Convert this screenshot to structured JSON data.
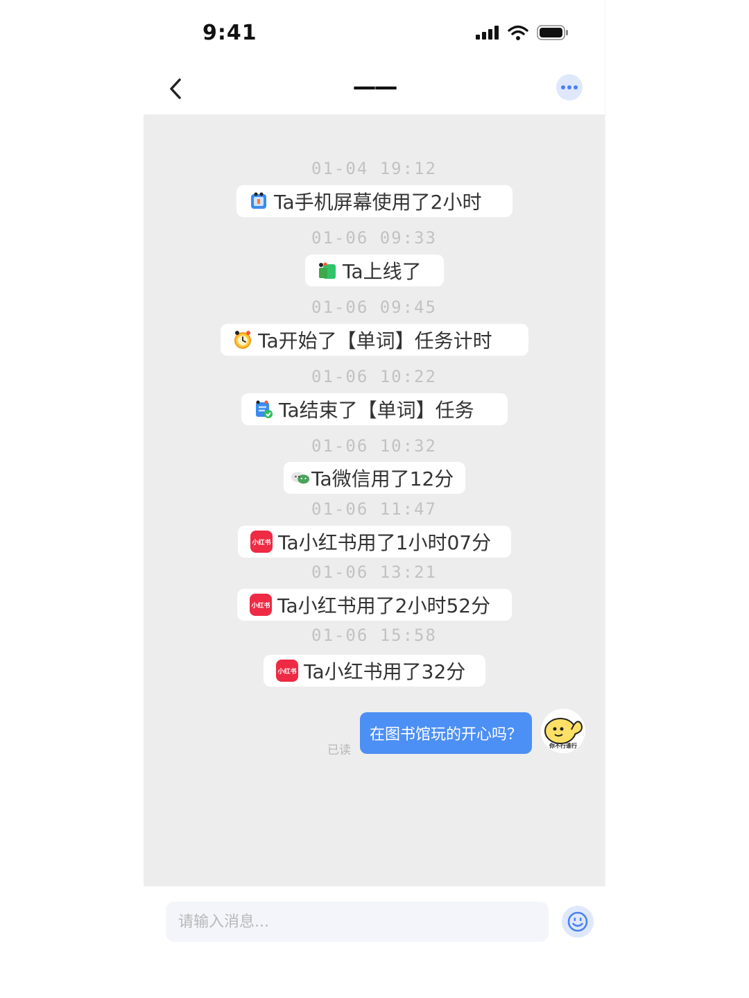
{
  "status_bar": {
    "time": "9:41"
  },
  "nav": {
    "title": "——"
  },
  "events": [
    {
      "timestamp": "01-04  19:12",
      "icon": "phone-screen-icon",
      "text": "Ta手机屏幕使用了2小时"
    },
    {
      "timestamp": "01-06  09:33",
      "icon": "online-app-icon",
      "text": "Ta上线了"
    },
    {
      "timestamp": "01-06  09:45",
      "icon": "alarm-clock-icon",
      "text": "Ta开始了【单词】任务计时"
    },
    {
      "timestamp": "01-06  10:22",
      "icon": "task-done-icon",
      "text": "Ta结束了【单词】任务"
    },
    {
      "timestamp": "01-06  10:32",
      "icon": "wechat-icon",
      "text": "Ta微信用了12分"
    },
    {
      "timestamp": "01-06  11:47",
      "icon": "xiaohongshu-icon",
      "text": "Ta小红书用了1小时07分"
    },
    {
      "timestamp": "01-06  13:21",
      "icon": "xiaohongshu-icon",
      "text": "Ta小红书用了2小时52分"
    },
    {
      "timestamp": "01-06  15:58",
      "icon": "xiaohongshu-icon",
      "text": "Ta小红书用了32分"
    }
  ],
  "xiaohongshu_logo_text": "小红书",
  "message": {
    "text": "在图书馆玩的开心吗？",
    "read_label": "已读",
    "avatar_caption": "你不行谁行"
  },
  "input": {
    "placeholder": "请输入消息..."
  },
  "colors": {
    "accent": "#4c8ff5",
    "chat_bg": "#ededed",
    "xiaohongshu": "#ee2a44"
  }
}
